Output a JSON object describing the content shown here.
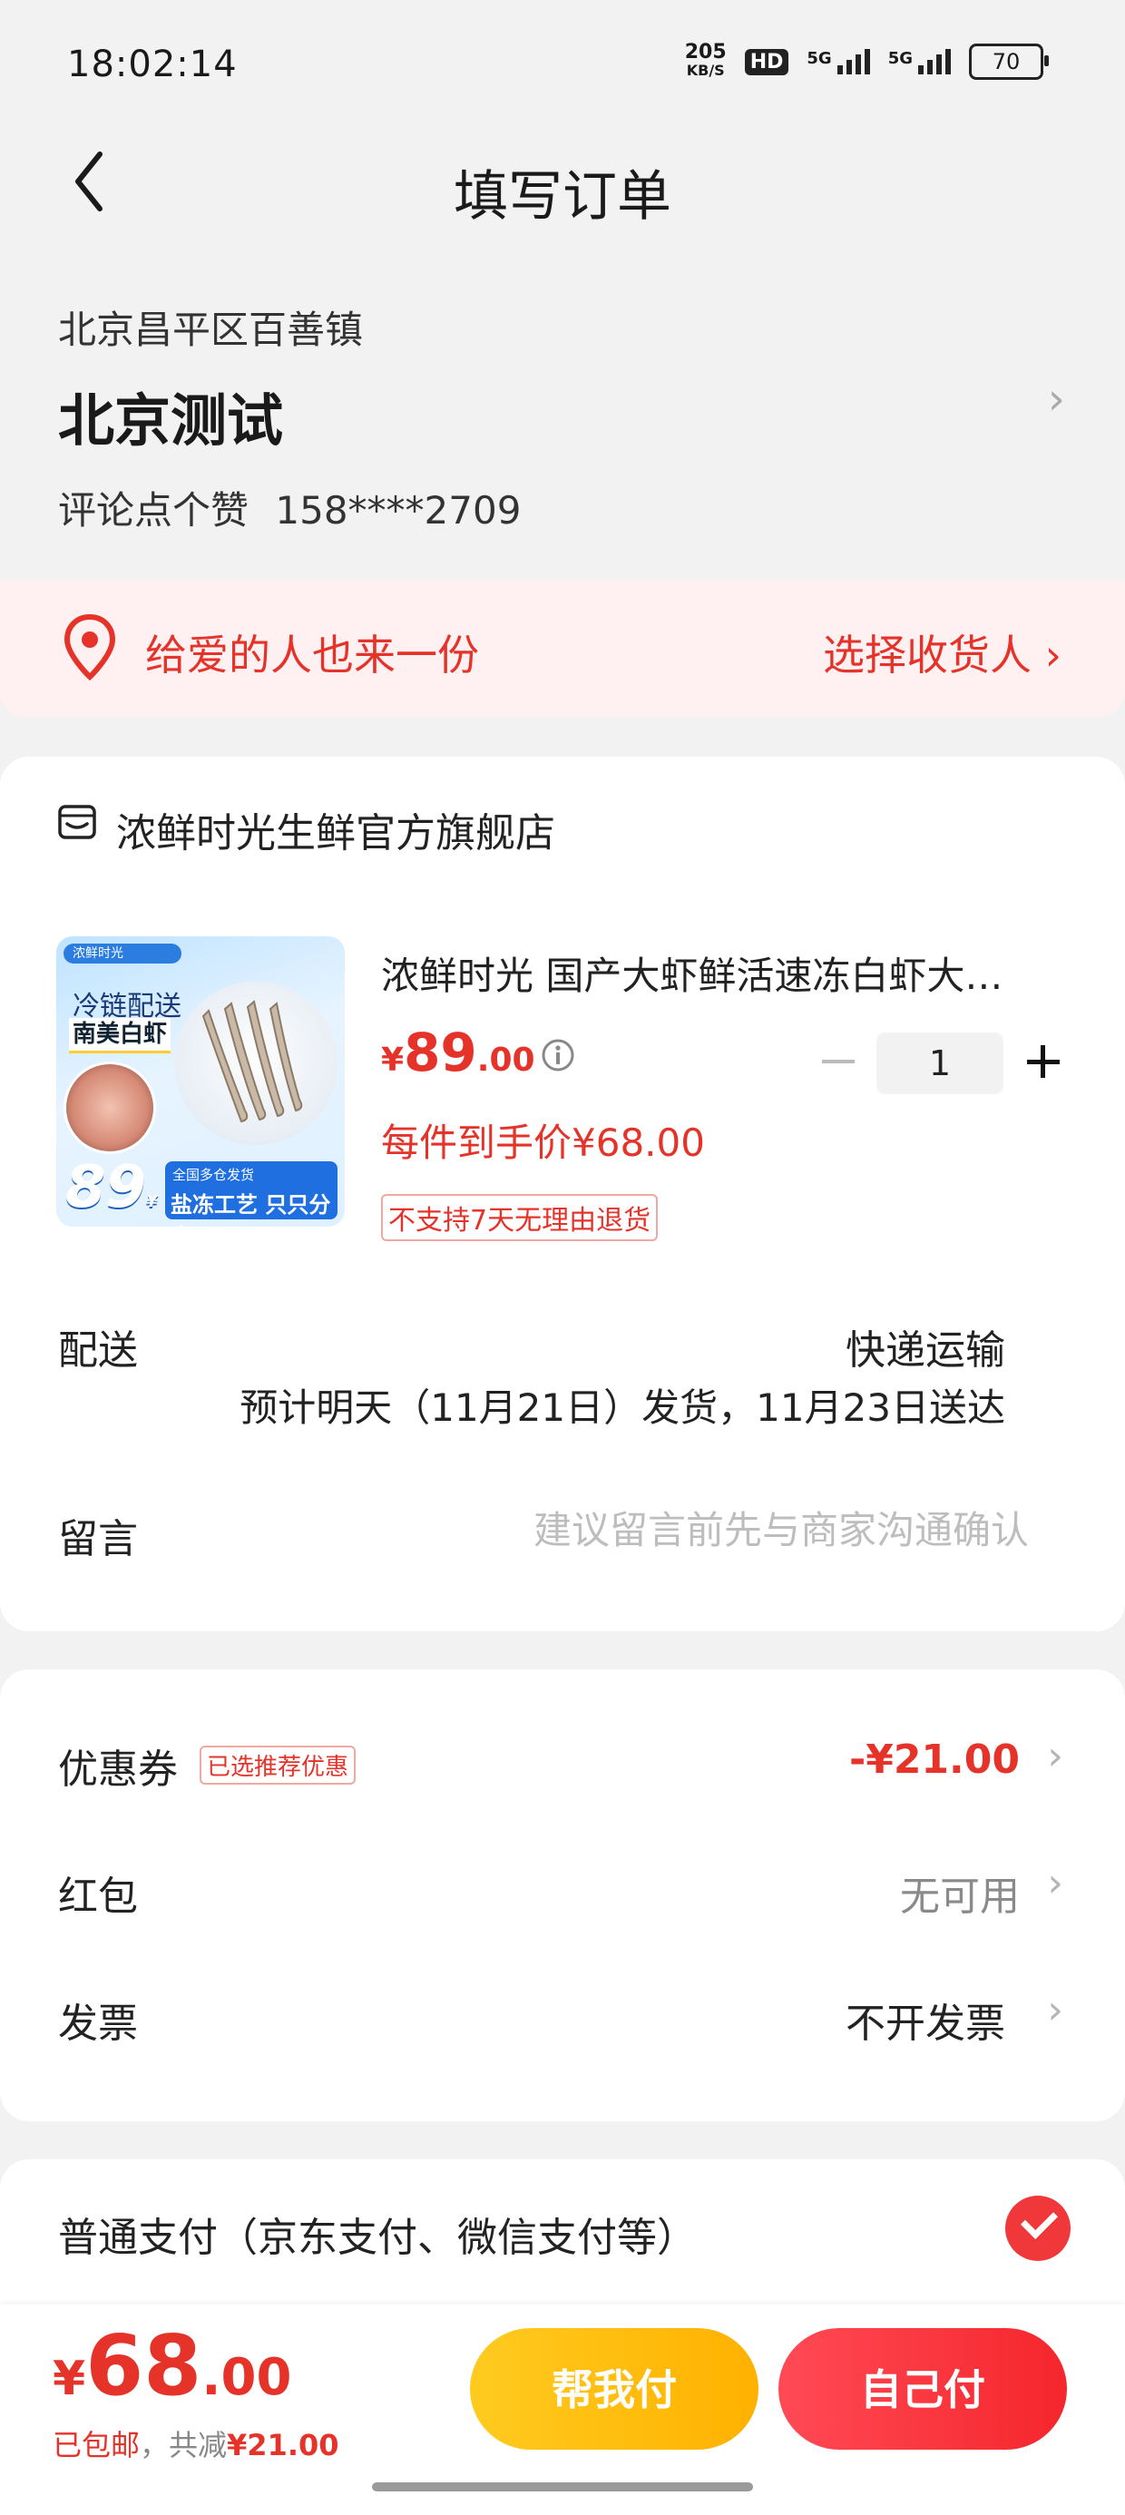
{
  "status_bar": {
    "time": "18:02:14",
    "net_speed_value": "205",
    "net_speed_unit": "KB/S",
    "hd_badge": "HD",
    "signal_1_label": "5G",
    "signal_2_label": "5G",
    "battery": "70"
  },
  "nav": {
    "title": "填写订单",
    "back_icon": "chevron-left-icon"
  },
  "address": {
    "region": "北京昌平区百善镇",
    "name": "北京测试",
    "contact_name": "评论点个赞",
    "phone": "158****2709",
    "chevron": "›"
  },
  "gift": {
    "text": "给爱的人也来一份",
    "action": "选择收货人 ›"
  },
  "shop": {
    "name": "浓鲜时光生鲜官方旗舰店",
    "product": {
      "title": "浓鲜时光 国产大虾鲜活速冻白虾大…",
      "image_badge": "浓鲜时光",
      "image_tag_cold": "冷链配送",
      "image_tag_kind": "南美白虾",
      "image_price": "89",
      "image_price_unit": "¥",
      "image_band_line1": "全国多仓发货",
      "image_band_line2": "盐冻工艺 只只分离",
      "price_currency": "¥",
      "price_int": "89",
      "price_dec": ".00",
      "quantity": "1",
      "unit_price_text": "每件到手价¥68.00",
      "return_policy": "不支持7天无理由退货"
    },
    "delivery": {
      "label": "配送",
      "method": "快递运输",
      "eta": "预计明天（11月21日）发货，11月23日送达"
    },
    "message": {
      "label": "留言",
      "placeholder": "建议留言前先与商家沟通确认"
    }
  },
  "fees": {
    "coupon": {
      "label": "优惠券",
      "tag": "已选推荐优惠",
      "value": "-¥21.00"
    },
    "red_packet": {
      "label": "红包",
      "value": "无可用"
    },
    "invoice": {
      "label": "发票",
      "value": "不开发票"
    },
    "chevron": "›"
  },
  "payment": {
    "label": "普通支付（京东支付、微信支付等）",
    "selected": true
  },
  "bottom": {
    "total_currency": "¥",
    "total_int": "68",
    "total_dec": ".00",
    "shipping": "已包邮",
    "saved_prefix": "，共减",
    "saved_amount": "¥21.00",
    "help_pay": "帮我付",
    "self_pay": "自己付"
  },
  "colors": {
    "accent_red": "#e5332a",
    "help_btn": "#ffb100",
    "self_btn": "#f5262c"
  }
}
